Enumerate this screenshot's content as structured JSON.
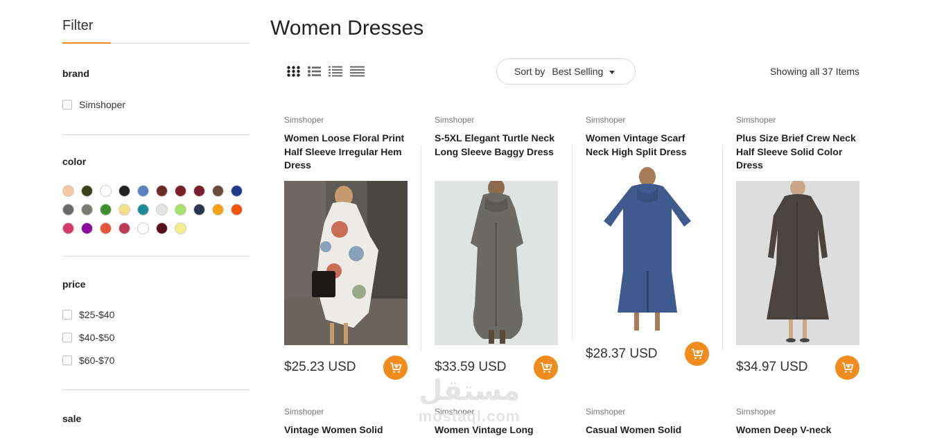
{
  "sidebar": {
    "filter_title": "Filter",
    "brand_title": "brand",
    "brand_options": [
      "Simshoper"
    ],
    "color_title": "color",
    "colors": [
      "#f7c6a2",
      "#3b4219",
      "#ffffff",
      "#222222",
      "#5b7fbf",
      "#6b2a22",
      "#7d1f2a",
      "#7a1d2c",
      "#6a4a3a",
      "#1f3a8a",
      "#6a6a6a",
      "#7a7a72",
      "#3f8f2a",
      "#f3e08a",
      "#1a8a94",
      "#e3e3e3",
      "#a8e06a",
      "#2a3650",
      "#f5a418",
      "#f2520a",
      "#d63a6a",
      "#8a0a9a",
      "#e4553a",
      "#c03a55",
      "#ffffff",
      "#5a0f1a",
      "#f2ee8e"
    ],
    "price_title": "price",
    "price_options": [
      "$25-$40",
      "$40-$50",
      "$60-$70"
    ],
    "sale_title": "sale"
  },
  "main": {
    "title": "Women Dresses",
    "sort_label": "Sort by",
    "sort_value": "Best Selling",
    "showing": "Showing all 37 Items"
  },
  "products": [
    {
      "brand": "Simshoper",
      "name": "Women Loose Floral Print Half Sleeve Irregular Hem Dress",
      "price": "$25.23 USD"
    },
    {
      "brand": "Simshoper",
      "name": "S-5XL Elegant Turtle Neck Long Sleeve Baggy Dress",
      "price": "$33.59 USD"
    },
    {
      "brand": "Simshoper",
      "name": "Women Vintage Scarf Neck High Split Dress",
      "price": "$28.37 USD"
    },
    {
      "brand": "Simshoper",
      "name": "Plus Size Brief Crew Neck Half Sleeve Solid Color Dress",
      "price": "$34.97 USD"
    }
  ],
  "products_row2": [
    {
      "brand": "Simshoper",
      "name": "Vintage Women Solid"
    },
    {
      "brand": "Simshoper",
      "name": "Women Vintage Long"
    },
    {
      "brand": "Simshoper",
      "name": "Casual Women Solid"
    },
    {
      "brand": "Simshoper",
      "name": "Women Deep V-neck"
    }
  ],
  "watermark": {
    "arabic": "مستقل",
    "latin": "mostaql.com"
  }
}
